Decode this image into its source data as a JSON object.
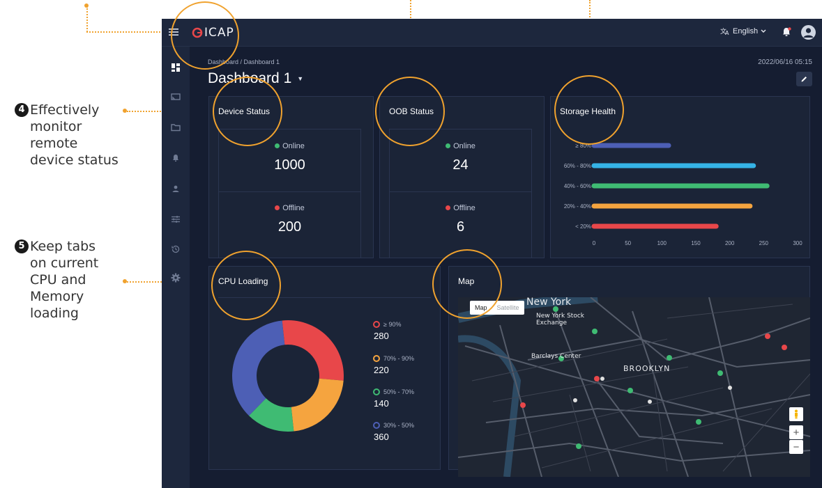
{
  "callouts": {
    "item4": {
      "number": "4",
      "lines": [
        "Effectively",
        "monitor",
        "remote",
        "device status"
      ]
    },
    "item5": {
      "number": "5",
      "lines": [
        "Keep tabs",
        "on current",
        "CPU and",
        "Memory",
        "loading"
      ]
    }
  },
  "header": {
    "logo_text": "ICAP",
    "language": "English",
    "icons": [
      "menu-icon",
      "translate-icon",
      "bell-icon",
      "user-avatar-icon"
    ]
  },
  "sidebar": {
    "items": [
      {
        "icon": "dashboard-icon"
      },
      {
        "icon": "device-icon"
      },
      {
        "icon": "folder-icon"
      },
      {
        "icon": "alert-icon"
      },
      {
        "icon": "user-icon"
      },
      {
        "icon": "settings-sliders-icon"
      },
      {
        "icon": "history-icon"
      },
      {
        "icon": "gear-icon"
      }
    ]
  },
  "page": {
    "breadcrumb": "Dashboard / Dashboard 1",
    "title": "Dashboard 1",
    "timestamp": "2022/06/16 05:15"
  },
  "device_status": {
    "title": "Device Status",
    "online_label": "Online",
    "online_value": "1000",
    "offline_label": "Offline",
    "offline_value": "200"
  },
  "oob_status": {
    "title": "OOB Status",
    "online_label": "Online",
    "online_value": "24",
    "offline_label": "Offline",
    "offline_value": "6"
  },
  "storage_health": {
    "title": "Storage Health"
  },
  "cpu_loading": {
    "title": "CPU Loading",
    "legend": [
      {
        "label": "≥ 90%",
        "value": "280",
        "color": "#e8474a"
      },
      {
        "label": "70% - 90%",
        "value": "220",
        "color": "#f5a43f"
      },
      {
        "label": "50% - 70%",
        "value": "140",
        "color": "#3fbb73"
      },
      {
        "label": "30% - 50%",
        "value": "360",
        "color": "#4d5fb5"
      }
    ]
  },
  "map": {
    "title": "Map",
    "toggle_map": "Map",
    "toggle_satellite": "Satellite",
    "labels": {
      "new_york": "New York",
      "stock_exchange": "New York Stock Exchange",
      "barclays": "Barclays Center",
      "brooklyn": "BROOKLYN"
    },
    "zoom_in": "+",
    "zoom_out": "−"
  },
  "chart_data": [
    {
      "type": "bar",
      "orientation": "horizontal",
      "title": "Storage Health",
      "categories": [
        "≥ 80%",
        "60% - 80%",
        "40% - 60%",
        "20% - 40%",
        "< 20%"
      ],
      "values": [
        110,
        235,
        255,
        230,
        180
      ],
      "colors": [
        "#4d5fb5",
        "#35b3e6",
        "#3fbb73",
        "#f5a43f",
        "#e8474a"
      ],
      "xlim": [
        0,
        300
      ],
      "x_ticks": [
        0,
        50,
        100,
        150,
        200,
        250,
        300
      ]
    },
    {
      "type": "pie",
      "donut": true,
      "title": "CPU Loading",
      "categories": [
        "≥ 90%",
        "70% - 90%",
        "50% - 70%",
        "30% - 50%"
      ],
      "values": [
        280,
        220,
        140,
        360
      ],
      "colors": [
        "#e8474a",
        "#f5a43f",
        "#3fbb73",
        "#4d5fb5"
      ]
    }
  ]
}
